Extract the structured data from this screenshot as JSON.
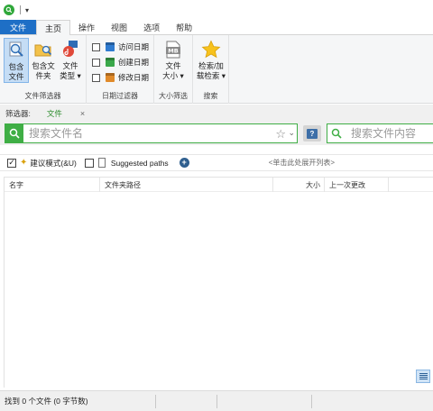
{
  "titlebar": {
    "quick_access": "│ ≡"
  },
  "tabs": [
    {
      "label": "文件"
    },
    {
      "label": "主页"
    },
    {
      "label": "操作"
    },
    {
      "label": "视图"
    },
    {
      "label": "选项"
    },
    {
      "label": "帮助"
    }
  ],
  "ribbon": {
    "file_filter": {
      "label": "文件筛选器",
      "buttons": [
        {
          "line1": "包含",
          "line2": "文件",
          "icon": "magnifier-document-icon",
          "selected": true
        },
        {
          "line1": "包含文",
          "line2": "件夹",
          "icon": "folder-search-icon"
        },
        {
          "line1": "文件",
          "line2": "类型 ▾",
          "icon": "file-type-icon"
        }
      ]
    },
    "date_filter": {
      "label": "日期过滤器",
      "items": [
        {
          "label": "访问日期",
          "color": "#2f7bd0"
        },
        {
          "label": "创建日期",
          "color": "#3aa84a"
        },
        {
          "label": "修改日期",
          "color": "#e08a2a"
        }
      ]
    },
    "size_filter": {
      "label": "大小筛选",
      "button": {
        "line1": "文件",
        "line2": "大小 ▾",
        "badge": "MB"
      }
    },
    "search": {
      "label": "搜索",
      "button": {
        "line1": "检索/加",
        "line2": "载检索 ▾"
      }
    }
  },
  "filterbar": {
    "label": "筛选器:",
    "tab": "文件",
    "close": "×"
  },
  "search": {
    "filename_placeholder": "搜索文件名",
    "content_placeholder": "搜索文件内容",
    "help": "?",
    "accent": "#3fae45"
  },
  "options": {
    "suggest_mode": "建议模式(&U)",
    "suggest_checked": "✓",
    "suggested_paths": "Suggested paths",
    "list_hint": "<单击此处展开列表>"
  },
  "table": {
    "columns": [
      {
        "label": "名字"
      },
      {
        "label": "文件夹路径"
      },
      {
        "label": "大小"
      },
      {
        "label": "上一次更改"
      }
    ]
  },
  "status": {
    "text": "找到 0 个文件 (0 字节数)"
  }
}
